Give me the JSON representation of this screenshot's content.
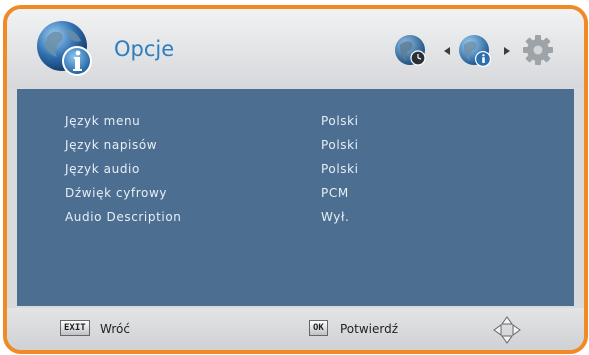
{
  "header": {
    "title": "Opcje",
    "icon": "globe-info-icon"
  },
  "settings": [
    {
      "label": "Język menu",
      "value": "Polski"
    },
    {
      "label": "Język napisów",
      "value": "Polski"
    },
    {
      "label": "Język audio",
      "value": "Polski"
    },
    {
      "label": "Dźwięk cyfrowy",
      "value": "PCM"
    },
    {
      "label": "Audio Description",
      "value": "Wył."
    }
  ],
  "footer": {
    "exit_key": "EXIT",
    "exit_label": "Wróć",
    "ok_key": "OK",
    "ok_label": "Potwierdź"
  },
  "colors": {
    "frame": "#f08a24",
    "content": "#4c6f91",
    "title": "#2e7dbf"
  }
}
